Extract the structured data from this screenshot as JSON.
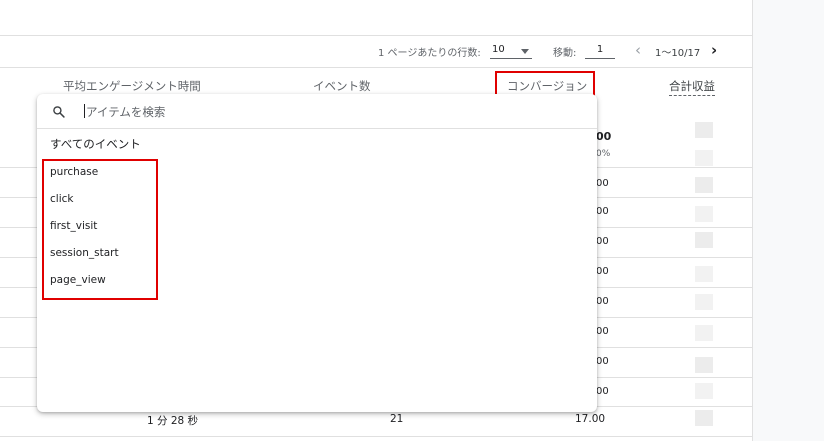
{
  "pager": {
    "rows_label": "1 ページあたりの行数:",
    "rows_value": "10",
    "goto_label": "移動:",
    "goto_value": "1",
    "range": "1〜10/17",
    "prev_icon": "chevron-left-icon",
    "next_icon": "chevron-right-icon"
  },
  "columns": {
    "engagement": "平均エンゲージメント時間",
    "events": "イベント数",
    "conversions": "コンバージョン",
    "revenue": "合計収益"
  },
  "conversion_cells": {
    "total": "00",
    "total_pct": "0%",
    "rows": [
      "00",
      "00",
      "00",
      "00",
      "00",
      "00",
      "00",
      "00"
    ]
  },
  "last_row": {
    "engagement": "1 分 28 秒",
    "events": "21",
    "conversions": "17.00"
  },
  "dropdown": {
    "search_icon": "search-icon",
    "placeholder": "アイテムを検索",
    "all_events": "すべてのイベント",
    "events": [
      "purchase",
      "click",
      "first_visit",
      "session_start",
      "page_view"
    ]
  },
  "highlight_color": "#e00000"
}
